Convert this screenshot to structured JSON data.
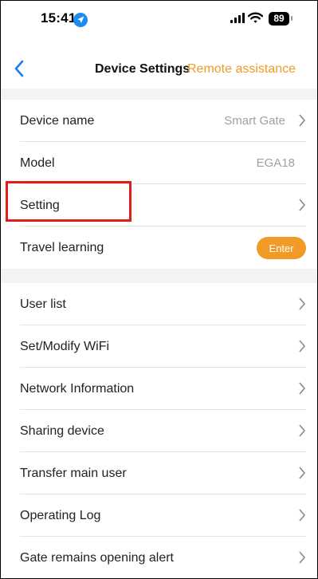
{
  "status_bar": {
    "time": "15:41",
    "battery": "89"
  },
  "nav": {
    "title": "Device Settings",
    "assist": "Remote assistance"
  },
  "group1": [
    {
      "label": "Device name",
      "value": "Smart Gate"
    },
    {
      "label": "Model",
      "value": "EGA18"
    },
    {
      "label": "Setting"
    },
    {
      "label": "Travel learning",
      "button": "Enter"
    }
  ],
  "group2": [
    {
      "label": "User list"
    },
    {
      "label": "Set/Modify WiFi"
    },
    {
      "label": "Network Information"
    },
    {
      "label": "Sharing device"
    },
    {
      "label": "Transfer main user"
    },
    {
      "label": "Operating Log"
    },
    {
      "label": "Gate remains opening alert"
    }
  ],
  "colors": {
    "accent": "#f29a26",
    "highlight": "#e21b1b"
  }
}
